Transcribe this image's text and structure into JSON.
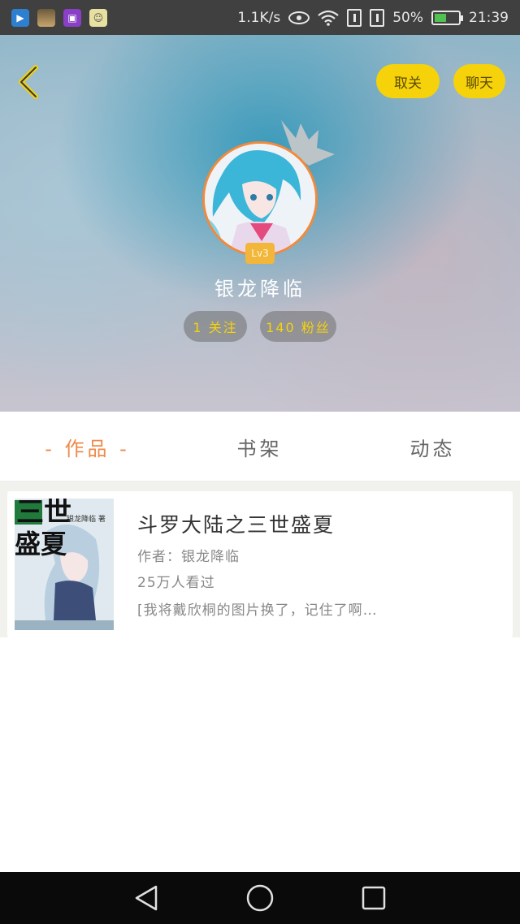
{
  "status_bar": {
    "speed": "1.1K/s",
    "battery": "50%",
    "battery_level": 0.5,
    "time": "21:39",
    "icons": [
      "video-app-icon",
      "photo-app-icon",
      "gallery-app-icon",
      "chat-app-icon",
      "eye-icon",
      "wifi-icon",
      "sim1-icon",
      "sim2-icon",
      "battery-icon"
    ]
  },
  "header": {
    "unfollow_label": "取关",
    "chat_label": "聊天"
  },
  "profile": {
    "level": "Lv3",
    "username": "银龙降临",
    "following": "1 关注",
    "fans": "140 粉丝"
  },
  "tabs": [
    {
      "label": "- 作品 -",
      "active": true
    },
    {
      "label": "书架",
      "active": false
    },
    {
      "label": "动态",
      "active": false
    }
  ],
  "works": [
    {
      "cover_text_line1": "三世",
      "cover_text_line2": "盛夏",
      "cover_author": "银龙降临 著",
      "title": "斗罗大陆之三世盛夏",
      "author": "作者：银龙降临",
      "views": "25万人看过",
      "description": "[我将戴欣桐的图片换了，记住了啊…"
    }
  ],
  "colors": {
    "accent_yellow": "#f5d20a",
    "active_tab": "#ef8a4a",
    "avatar_border": "#f08a3c",
    "level_badge": "#f2b63a"
  }
}
